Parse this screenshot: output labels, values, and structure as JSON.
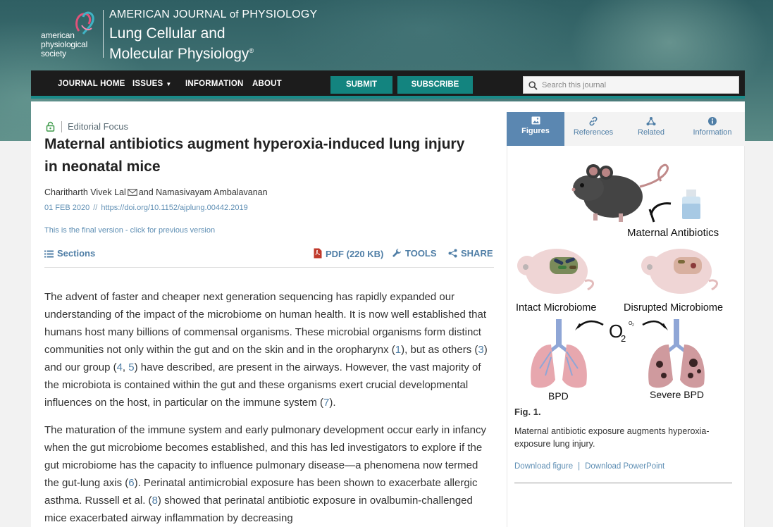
{
  "header": {
    "society_lines": [
      "american",
      "physiological",
      "society"
    ],
    "journal_top_main": "AMERICAN JOURNAL",
    "journal_top_of": "of",
    "journal_top_end": "PHYSIOLOGY",
    "journal_name_line1": "Lung Cellular and",
    "journal_name_line2": "Molecular Physiology",
    "registered_mark": "®"
  },
  "nav": {
    "items": [
      "JOURNAL HOME",
      "ISSUES",
      "INFORMATION",
      "ABOUT"
    ],
    "submit": "SUBMIT",
    "subscribe": "SUBSCRIBE",
    "search_placeholder": "Search this journal"
  },
  "article": {
    "section_label": "Editorial Focus",
    "title": "Maternal antibiotics augment hyperoxia-induced lung injury in neonatal mice",
    "author1": "Charitharth Vivek Lal",
    "author_join": "and Namasivayam Ambalavanan",
    "date": "01 FEB 2020",
    "meta_sep": "//",
    "doi": "https://doi.org/10.1152/ajplung.00442.2019",
    "version_note": "This is the final version - click for previous version",
    "toolbar": {
      "sections": "Sections",
      "pdf": "PDF (220 KB)",
      "tools": "TOOLS",
      "share": "SHARE"
    },
    "paragraph1": [
      {
        "t": "The advent of faster and cheaper next generation sequencing has rapidly expanded our understanding of the impact of the microbiome on human health. It is now well established that humans host many billions of commensal organisms. These microbial organisms form distinct communities not only within the gut and on the skin and in the oropharynx ("
      },
      {
        "r": "1"
      },
      {
        "t": "), but as others ("
      },
      {
        "r": "3"
      },
      {
        "t": ") and our group ("
      },
      {
        "r": "4"
      },
      {
        "t": ", "
      },
      {
        "r": "5"
      },
      {
        "t": ") have described, are present in the airways. However, the vast majority of the microbiota is contained within the gut and these organisms exert crucial developmental influences on the host, in particular on the immune system ("
      },
      {
        "r": "7"
      },
      {
        "t": ")."
      }
    ],
    "paragraph2": [
      {
        "t": "The maturation of the immune system and early pulmonary development occur early in infancy when the gut microbiome becomes established, and this has led investigators to explore if the gut microbiome has the capacity to influence pulmonary disease—a phenomena now termed the gut-lung axis ("
      },
      {
        "r": "6"
      },
      {
        "t": "). Perinatal antimicrobial exposure has been shown to exacerbate allergic asthma. Russell et al. ("
      },
      {
        "r": "8"
      },
      {
        "t": ") showed that perinatal antibiotic exposure in ovalbumin-challenged mice exacerbated airway inflammation by decreasing"
      }
    ]
  },
  "panel": {
    "tabs": [
      "Figures",
      "References",
      "Related",
      "Information"
    ],
    "figure": {
      "labels": {
        "maternal": "Maternal Antibiotics",
        "intact": "Intact Microbiome",
        "disrupted": "Disrupted Microbiome",
        "o2": "O",
        "o2_sub": "2",
        "o2_small": "O",
        "o2_small_sub": "2",
        "bpd": "BPD",
        "severe_bpd": "Severe BPD"
      },
      "fig_label": "Fig. 1.",
      "caption": "Maternal antibiotic exposure augments hyperoxia-exposure lung injury.",
      "download_figure": "Download figure",
      "links_sep": "|",
      "download_ppt": "Download PowerPoint"
    }
  },
  "colors": {
    "nav_bg": "#1c1c1c",
    "accent_teal": "#13847f",
    "link_blue": "#4f7ea6",
    "tab_active": "#5b87b1",
    "pdf_red": "#c0392b"
  },
  "icons": [
    "lock-icon",
    "mail-icon",
    "menu-icon",
    "pdf-icon",
    "wrench-icon",
    "share-icon",
    "search-icon",
    "image-icon",
    "link-icon",
    "network-icon",
    "info-icon",
    "chevron-down-icon"
  ]
}
